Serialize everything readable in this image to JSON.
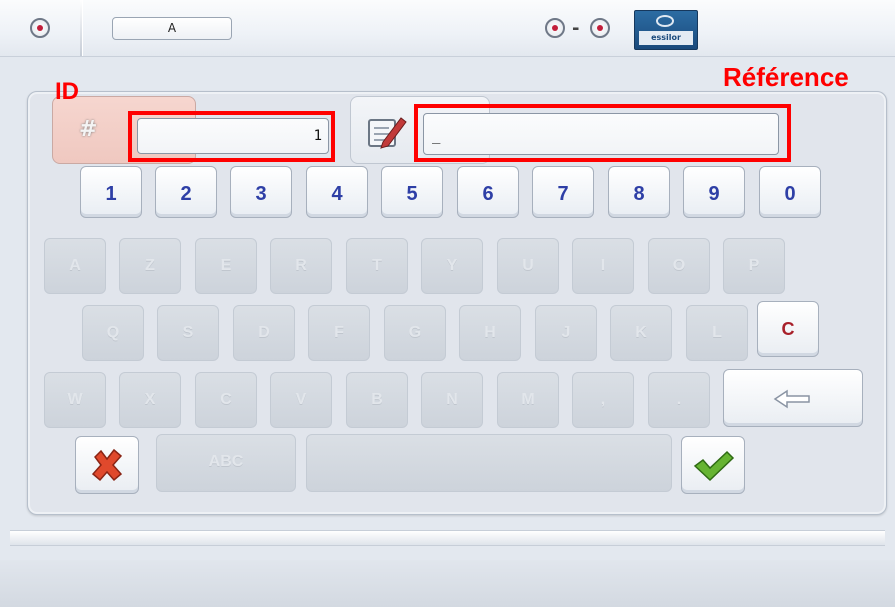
{
  "topbar": {
    "tab_value": "A",
    "logo_text": "essilor",
    "icons": [
      "left-circle-icon",
      "pair-circle-icon",
      "logo-icon"
    ]
  },
  "annotations": {
    "id_label": "ID",
    "reference_label": "Référence",
    "highlight_color": "#ff0000"
  },
  "form": {
    "id_symbol": "#",
    "id_value": "1",
    "reference_value": "_"
  },
  "keyboard": {
    "number_row": [
      "1",
      "2",
      "3",
      "4",
      "5",
      "6",
      "7",
      "8",
      "9",
      "0"
    ],
    "row1": [
      "A",
      "Z",
      "E",
      "R",
      "T",
      "Y",
      "U",
      "I",
      "O",
      "P"
    ],
    "row2": [
      "Q",
      "S",
      "D",
      "F",
      "G",
      "H",
      "J",
      "K",
      "L"
    ],
    "row3": [
      "W",
      "X",
      "C",
      "V",
      "B",
      "N",
      "M",
      ",",
      "."
    ],
    "clear_label": "C",
    "abc_label": "ABC",
    "number_key_color": "#2e3fa6",
    "clear_key_color": "#a8202a"
  },
  "actions": {
    "cancel_icon": "red-x-icon",
    "confirm_icon": "green-check-icon",
    "backspace_icon": "backspace-arrow-icon"
  }
}
